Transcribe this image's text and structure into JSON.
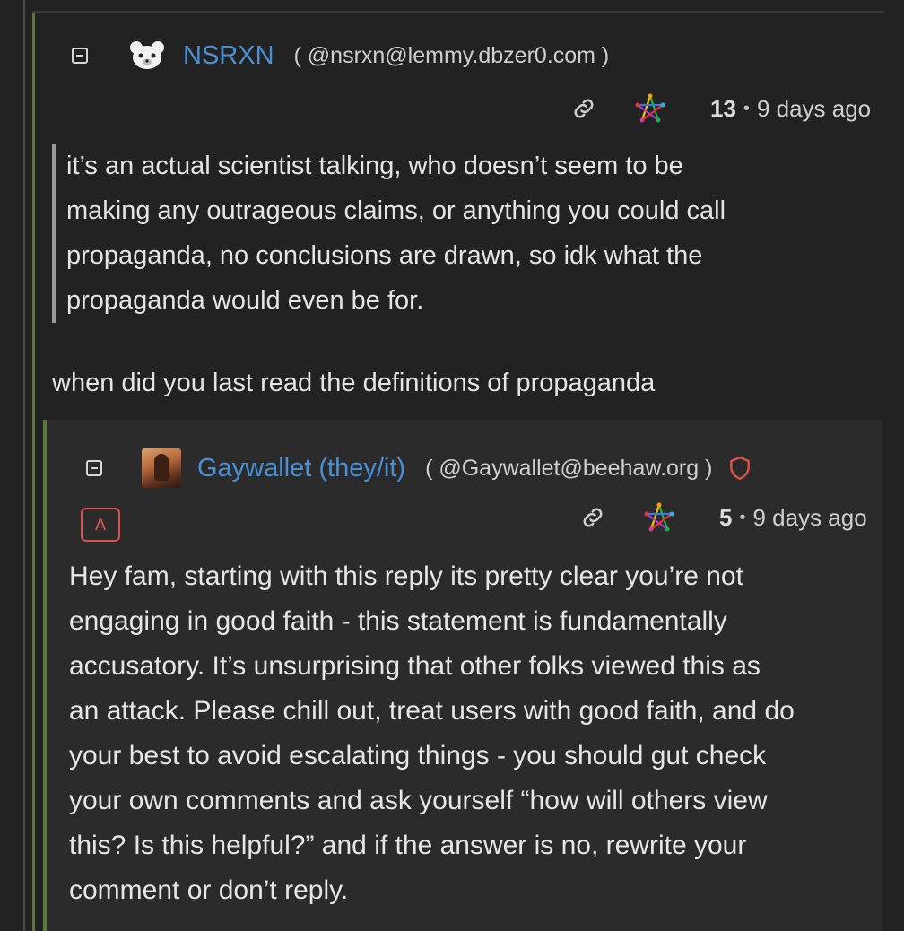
{
  "comment": {
    "username": "NSRXN",
    "handle": "( @nsrxn@lemmy.dbzer0.com )",
    "score": "13",
    "age": "9 days ago",
    "quote_lines": [
      "it’s an actual scientist talking, who doesn’t seem to be",
      "making any outrageous claims, or anything you could call",
      "propaganda, no conclusions are drawn, so idk what the",
      "propaganda would even be for."
    ],
    "body": "when did you last read the definitions of propaganda"
  },
  "reply": {
    "username": "Gaywallet (they/it)",
    "handle": "( @Gaywallet@beehaw.org )",
    "admin_badge": "A",
    "score": "5",
    "age": "9 days ago",
    "body_lines": [
      "Hey fam, starting with this reply its pretty clear you’re not",
      "engaging in good faith - this statement is fundamentally",
      "accusatory. It’s unsurprising that other folks viewed this as",
      "an attack. Please chill out, treat users with good faith, and do",
      "your best to avoid escalating things - you should gut check",
      "your own comments and ask yourself “how will others view",
      "this? Is this helpful?” and if the answer is no, rewrite your",
      "comment or don’t reply."
    ]
  },
  "icons": {
    "collapse": "collapse-icon",
    "link": "link-icon",
    "fediverse": "fediverse-icon",
    "moderator": "shield-icon"
  },
  "colors": {
    "background": "#222222",
    "reply_background": "#2b2b2b",
    "username": "#4a90d6",
    "thread_line": "#5d7a3c",
    "moderator_badge": "#d9534f"
  }
}
